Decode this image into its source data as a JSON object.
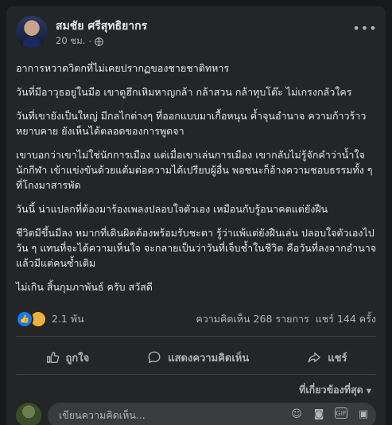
{
  "post": {
    "author": "สมชัย ศรีสุทธิยากร",
    "time": "20 ชม.",
    "paragraphs": [
      "อาการหวาดวิตกที่ไม่เคยปรากฏของชายชาติทหาร",
      "วันที่มีอาวุธอยู่ในมือ เขาดูฮึกเหิมหาญกล้า กล้าสวน กล้าทุบโต๊ะ ไม่เกรงกลัวใคร",
      "วันที่เขายังเป็นใหญ่ มีกลไกต่างๆ ที่ออกแบบมาเกื้อหนุน ค้ำจุนอำนาจ ความก้าวร้าวหยาบคาย ยังเห็นได้ตลอดของการพูดจา",
      "เขาบอกว่าเขาไม่ใช่นักการเมือง แต่เมื่อเขาเล่นการเมือง เขากลับไม่รู้จักคำว่าน้ำใจนักกีฬา เข้าแข่งขันด้วยแต้มต่อความได้เปรียบผู้อื่น พอชนะก็อ้างความชอบธรรมทั้ง ๆ ที่โกงมาสารพัด",
      "วันนี้ น่าแปลกที่ต้องมาร้องเพลงปลอบใจตัวเอง เหมือนกับรู้อนาคตแต่ยังฝืน",
      "ชีวิตมีขึ้นมีลง หมากที่เดินผิดต้องพร้อมรับชะตา รู้ว่าแพ้แต่ยังฝืนเล่น ปลอบใจตัวเองไปวัน ๆ แทนที่จะได้ความเห็นใจ จะกลายเป็นว่าวันที่เจ็บช้ำในชีวิต คือวันที่ลงจากอำนาจแล้วมีแต่คนซ้ำเติม",
      "ไม่เกิน สิ้นกุมภาพันธ์ ครับ สวัสดี"
    ]
  },
  "stats": {
    "reactions": "2.1 พัน",
    "comments": "ความคิดเห็น 268 รายการ",
    "shares": "แชร์ 144 ครั้ง"
  },
  "actions": {
    "like": "ถูกใจ",
    "comment": "แสดงความคิดเห็น",
    "share": "แชร์"
  },
  "filter": {
    "label": "ที่เกี่ยวข้องที่สุด"
  },
  "comment_box": {
    "placeholder": "เขียนความคิดเห็น..."
  },
  "icons": {
    "privacy": "globe-icon",
    "more": "more-options-icon",
    "like": "thumbs-up-icon",
    "comment": "speech-bubble-icon",
    "share": "share-arrow-icon",
    "filter": "chevron-down-icon",
    "emoji": "smiley-icon",
    "camera": "camera-icon",
    "gif": "gif-icon",
    "sticker": "sticker-icon"
  },
  "colors": {
    "background": "#18191a",
    "card": "#242526",
    "text": "#e4e6eb",
    "secondary_text": "#b0b3b8",
    "like_blue": "#1877f2",
    "haha_yellow": "#f7b125"
  }
}
